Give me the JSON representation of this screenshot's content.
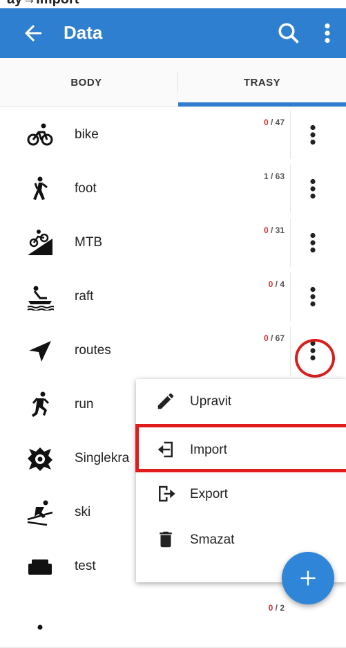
{
  "page_caption_fragment": "ay→Import",
  "appbar": {
    "title": "Data",
    "back_icon": "arrow-left-icon",
    "search_icon": "search-icon",
    "more_icon": "more-vert-icon",
    "color": "#2f7fd0"
  },
  "tabs": [
    {
      "label": "BODY",
      "selected": false
    },
    {
      "label": "TRASY",
      "selected": true
    }
  ],
  "rows": [
    {
      "label": "bike",
      "selected_count": "0",
      "total": "47",
      "selected_highlight": true,
      "icon": "bicycle-icon"
    },
    {
      "label": "foot",
      "selected_count": "1",
      "total": "63",
      "selected_highlight": false,
      "icon": "hiker-icon"
    },
    {
      "label": "MTB",
      "selected_count": "0",
      "total": "31",
      "selected_highlight": true,
      "icon": "mountain-bike-icon"
    },
    {
      "label": "raft",
      "selected_count": "0",
      "total": "4",
      "selected_highlight": true,
      "icon": "raft-icon"
    },
    {
      "label": "routes",
      "selected_count": "0",
      "total": "67",
      "selected_highlight": true,
      "icon": "navigation-arrow-icon"
    },
    {
      "label": "run",
      "selected_count": "",
      "total": "",
      "selected_highlight": false,
      "icon": "runner-icon"
    },
    {
      "label": "Singlekra",
      "selected_count": "",
      "total": "",
      "selected_highlight": false,
      "icon": "singletrack-icon"
    },
    {
      "label": "ski",
      "selected_count": "",
      "total": "",
      "selected_highlight": false,
      "icon": "skier-icon"
    },
    {
      "label": "test",
      "selected_count": "",
      "total": "",
      "selected_highlight": false,
      "icon": "sofa-icon"
    },
    {
      "label": "",
      "selected_count": "0",
      "total": "2",
      "selected_highlight": true,
      "icon": "hiker-icon"
    }
  ],
  "context_menu": {
    "items": [
      {
        "label": "Upravit",
        "icon": "pencil-icon"
      },
      {
        "label": "Import",
        "icon": "import-icon"
      },
      {
        "label": "Export",
        "icon": "export-icon"
      },
      {
        "label": "Smazat",
        "icon": "trash-icon"
      }
    ]
  },
  "fab": {
    "icon": "plus-icon"
  },
  "colors": {
    "highlight_red": "#d81e1e",
    "count_red": "#d32f2f",
    "accent_blue": "#2f86d8"
  }
}
